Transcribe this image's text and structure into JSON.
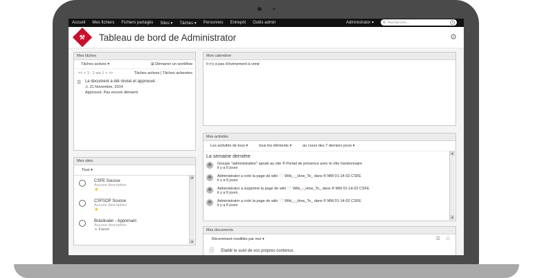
{
  "topnav": {
    "items": [
      "Accueil",
      "Mes fichiers",
      "Fichiers partagés",
      "Sites ▾",
      "Tâches ▾",
      "Personnes",
      "Entrepôt",
      "Outils admin"
    ],
    "user": "Administrator ▾",
    "search_placeholder": "Recherche..."
  },
  "header": {
    "title": "Tableau de bord de Administrator"
  },
  "tasks": {
    "title": "Mes tâches",
    "filter": "Tâches actives ▾",
    "workflow": "Démarrer un workflow",
    "pager": "<< < 1 - 1 sur 1 > >>",
    "links": "Tâches actives | Tâches achevées",
    "item": {
      "name": "Le document a été révisé et approuvé.",
      "date": "21 Novembre, 2014",
      "status": "Approuvé, Pas encore démarré"
    }
  },
  "calendar": {
    "title": "Mon calendrier",
    "empty": "Il n'y a pas d'événement à venir"
  },
  "activities": {
    "title": "Mes activités",
    "filters": [
      "Les activités de tous ▾",
      "tous les éléments ▾",
      "au cours des 7 derniers jours ▾"
    ],
    "section": "La semaine dernière",
    "items": [
      {
        "text": "Groupe \"administration\" ajouté au site ® Portail de présence avec le rôle Gestionnaire",
        "time": "il y a 6 jours"
      },
      {
        "text": "Administrator a créé la page de wiki 📄 Wiki_-_How_To_ dans ® MM 01-14-02 CSFE",
        "time": "il y a 6 jours"
      },
      {
        "text": "Administrator a supprimé la page de wiki 📄 Wiki_-_How_To_ dans ® MM 01-14-02 CSFE",
        "time": "il y a 6 jours"
      },
      {
        "text": "Administrator a créé la page de wiki 📄 Wiki_-_How_To_ dans ® MM 01-14-02 CSFE",
        "time": "il y a 6 jours"
      }
    ]
  },
  "sites": {
    "title": "Mes sites",
    "filter": "Tous ▾",
    "items": [
      {
        "name": "CSFE Sousse",
        "desc": "Aucune description"
      },
      {
        "name": "CSFSOP Sousse",
        "desc": "Aucune description"
      },
      {
        "name": "Bräslinaler - Apprenant",
        "desc": "Aucune description",
        "fav": "Favori"
      }
    ]
  },
  "documents": {
    "title": "Mes documents",
    "filter": "Récemment modifiés par moi ▾",
    "item": "Etablir le suivi de vos propres contenus"
  }
}
